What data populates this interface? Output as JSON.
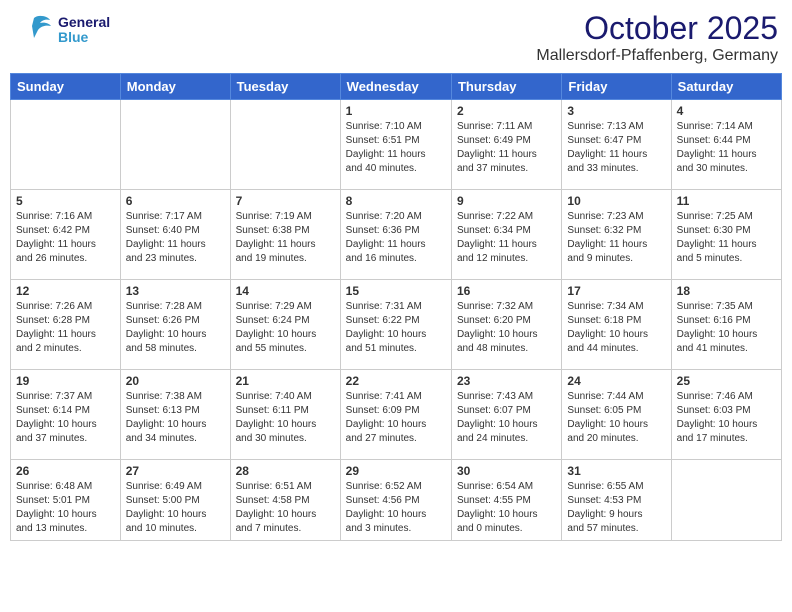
{
  "header": {
    "logo_general": "General",
    "logo_blue": "Blue",
    "month": "October 2025",
    "location": "Mallersdorf-Pfaffenberg, Germany"
  },
  "weekdays": [
    "Sunday",
    "Monday",
    "Tuesday",
    "Wednesday",
    "Thursday",
    "Friday",
    "Saturday"
  ],
  "weeks": [
    [
      {
        "day": "",
        "info": ""
      },
      {
        "day": "",
        "info": ""
      },
      {
        "day": "",
        "info": ""
      },
      {
        "day": "1",
        "info": "Sunrise: 7:10 AM\nSunset: 6:51 PM\nDaylight: 11 hours\nand 40 minutes."
      },
      {
        "day": "2",
        "info": "Sunrise: 7:11 AM\nSunset: 6:49 PM\nDaylight: 11 hours\nand 37 minutes."
      },
      {
        "day": "3",
        "info": "Sunrise: 7:13 AM\nSunset: 6:47 PM\nDaylight: 11 hours\nand 33 minutes."
      },
      {
        "day": "4",
        "info": "Sunrise: 7:14 AM\nSunset: 6:44 PM\nDaylight: 11 hours\nand 30 minutes."
      }
    ],
    [
      {
        "day": "5",
        "info": "Sunrise: 7:16 AM\nSunset: 6:42 PM\nDaylight: 11 hours\nand 26 minutes."
      },
      {
        "day": "6",
        "info": "Sunrise: 7:17 AM\nSunset: 6:40 PM\nDaylight: 11 hours\nand 23 minutes."
      },
      {
        "day": "7",
        "info": "Sunrise: 7:19 AM\nSunset: 6:38 PM\nDaylight: 11 hours\nand 19 minutes."
      },
      {
        "day": "8",
        "info": "Sunrise: 7:20 AM\nSunset: 6:36 PM\nDaylight: 11 hours\nand 16 minutes."
      },
      {
        "day": "9",
        "info": "Sunrise: 7:22 AM\nSunset: 6:34 PM\nDaylight: 11 hours\nand 12 minutes."
      },
      {
        "day": "10",
        "info": "Sunrise: 7:23 AM\nSunset: 6:32 PM\nDaylight: 11 hours\nand 9 minutes."
      },
      {
        "day": "11",
        "info": "Sunrise: 7:25 AM\nSunset: 6:30 PM\nDaylight: 11 hours\nand 5 minutes."
      }
    ],
    [
      {
        "day": "12",
        "info": "Sunrise: 7:26 AM\nSunset: 6:28 PM\nDaylight: 11 hours\nand 2 minutes."
      },
      {
        "day": "13",
        "info": "Sunrise: 7:28 AM\nSunset: 6:26 PM\nDaylight: 10 hours\nand 58 minutes."
      },
      {
        "day": "14",
        "info": "Sunrise: 7:29 AM\nSunset: 6:24 PM\nDaylight: 10 hours\nand 55 minutes."
      },
      {
        "day": "15",
        "info": "Sunrise: 7:31 AM\nSunset: 6:22 PM\nDaylight: 10 hours\nand 51 minutes."
      },
      {
        "day": "16",
        "info": "Sunrise: 7:32 AM\nSunset: 6:20 PM\nDaylight: 10 hours\nand 48 minutes."
      },
      {
        "day": "17",
        "info": "Sunrise: 7:34 AM\nSunset: 6:18 PM\nDaylight: 10 hours\nand 44 minutes."
      },
      {
        "day": "18",
        "info": "Sunrise: 7:35 AM\nSunset: 6:16 PM\nDaylight: 10 hours\nand 41 minutes."
      }
    ],
    [
      {
        "day": "19",
        "info": "Sunrise: 7:37 AM\nSunset: 6:14 PM\nDaylight: 10 hours\nand 37 minutes."
      },
      {
        "day": "20",
        "info": "Sunrise: 7:38 AM\nSunset: 6:13 PM\nDaylight: 10 hours\nand 34 minutes."
      },
      {
        "day": "21",
        "info": "Sunrise: 7:40 AM\nSunset: 6:11 PM\nDaylight: 10 hours\nand 30 minutes."
      },
      {
        "day": "22",
        "info": "Sunrise: 7:41 AM\nSunset: 6:09 PM\nDaylight: 10 hours\nand 27 minutes."
      },
      {
        "day": "23",
        "info": "Sunrise: 7:43 AM\nSunset: 6:07 PM\nDaylight: 10 hours\nand 24 minutes."
      },
      {
        "day": "24",
        "info": "Sunrise: 7:44 AM\nSunset: 6:05 PM\nDaylight: 10 hours\nand 20 minutes."
      },
      {
        "day": "25",
        "info": "Sunrise: 7:46 AM\nSunset: 6:03 PM\nDaylight: 10 hours\nand 17 minutes."
      }
    ],
    [
      {
        "day": "26",
        "info": "Sunrise: 6:48 AM\nSunset: 5:01 PM\nDaylight: 10 hours\nand 13 minutes."
      },
      {
        "day": "27",
        "info": "Sunrise: 6:49 AM\nSunset: 5:00 PM\nDaylight: 10 hours\nand 10 minutes."
      },
      {
        "day": "28",
        "info": "Sunrise: 6:51 AM\nSunset: 4:58 PM\nDaylight: 10 hours\nand 7 minutes."
      },
      {
        "day": "29",
        "info": "Sunrise: 6:52 AM\nSunset: 4:56 PM\nDaylight: 10 hours\nand 3 minutes."
      },
      {
        "day": "30",
        "info": "Sunrise: 6:54 AM\nSunset: 4:55 PM\nDaylight: 10 hours\nand 0 minutes."
      },
      {
        "day": "31",
        "info": "Sunrise: 6:55 AM\nSunset: 4:53 PM\nDaylight: 9 hours\nand 57 minutes."
      },
      {
        "day": "",
        "info": ""
      }
    ]
  ]
}
